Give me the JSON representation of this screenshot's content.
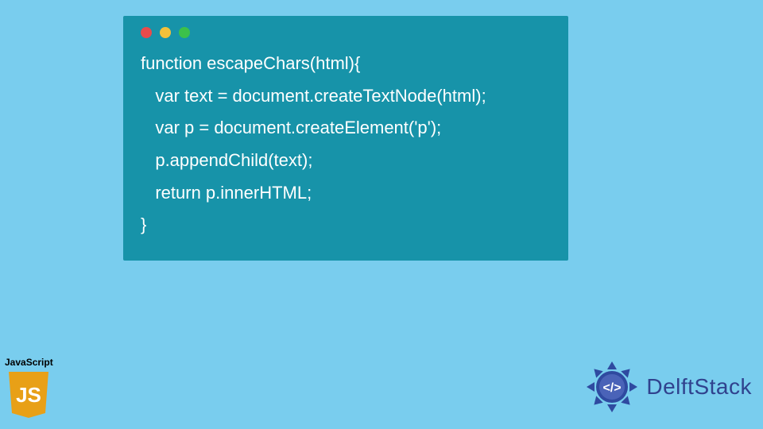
{
  "code": {
    "lines": [
      "function escapeChars(html){",
      "   var text = document.createTextNode(html);",
      "   var p = document.createElement('p');",
      "   p.appendChild(text);",
      "   return p.innerHTML;",
      "}"
    ]
  },
  "jsBadge": {
    "label": "JavaScript",
    "glyph": "JS"
  },
  "brand": {
    "name": "DelftStack",
    "glyph": "</>"
  },
  "colors": {
    "background": "#79cdee",
    "window": "#1793a9",
    "codeText": "#ffffff",
    "trafficRed": "#e94b4b",
    "trafficYellow": "#f3c13a",
    "trafficGreen": "#3cc14a",
    "jsShield": "#e8a017",
    "brandPrimary": "#30428e"
  }
}
